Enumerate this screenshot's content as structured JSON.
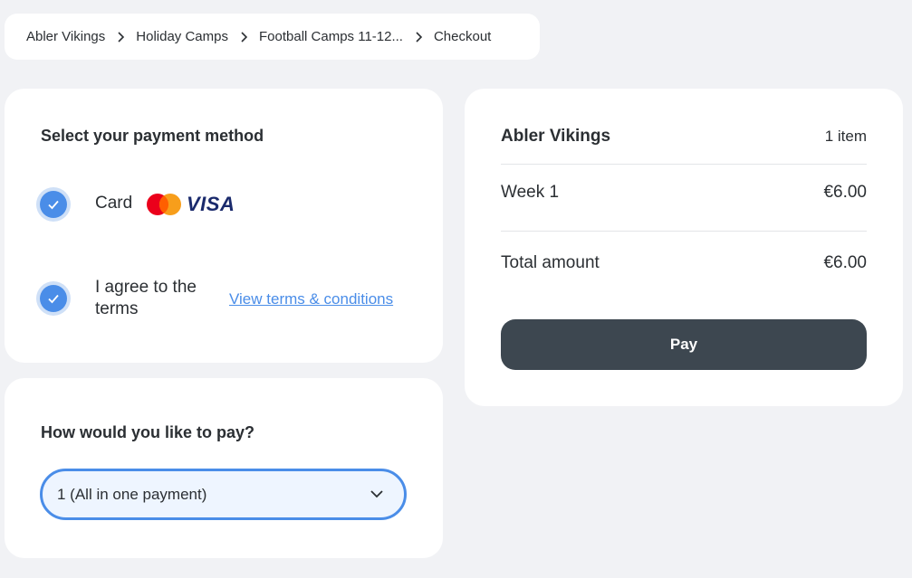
{
  "breadcrumb": {
    "items": [
      "Abler Vikings",
      "Holiday Camps",
      "Football Camps 11-12...",
      "Checkout"
    ]
  },
  "payment_method": {
    "title": "Select your payment method",
    "card_label": "Card",
    "card_brands": [
      "mastercard-icon",
      "visa-icon"
    ],
    "visa_text": "VISA",
    "agree_text": "I agree to the terms",
    "terms_link": "View terms & conditions"
  },
  "installments": {
    "title": "How would you like to pay?",
    "selected": "1 (All in one payment)"
  },
  "summary": {
    "club": "Abler Vikings",
    "item_count": "1 item",
    "lines": [
      {
        "label": "Week 1",
        "value": "€6.00"
      }
    ],
    "total_label": "Total amount",
    "total_value": "€6.00",
    "pay_label": "Pay"
  },
  "colors": {
    "accent": "#4a8de8",
    "pay_button": "#3d4750",
    "background": "#f1f2f5"
  }
}
